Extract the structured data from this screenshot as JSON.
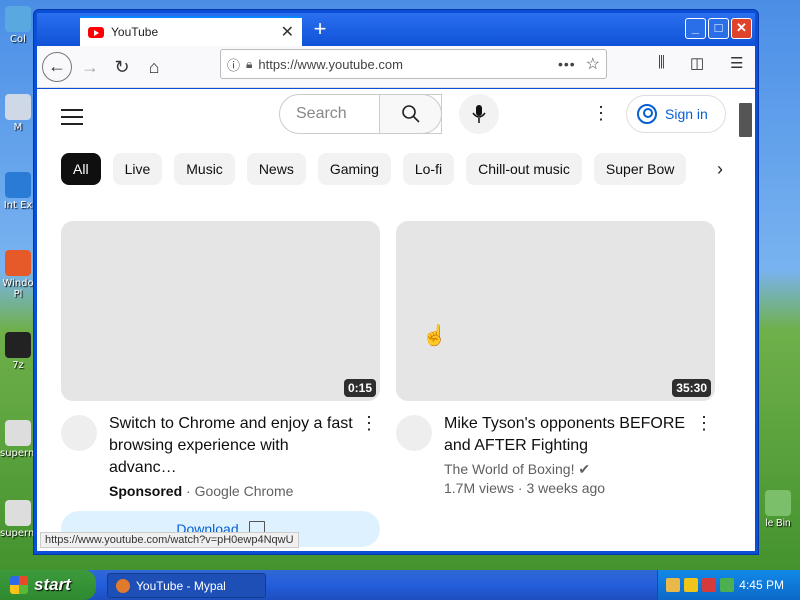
{
  "desktop": {
    "icons_left": [
      "Col",
      "M",
      "Int\nEx",
      "Windo\nPl",
      "7z",
      "superm",
      "superm"
    ],
    "icon_right": "le Bin"
  },
  "browser": {
    "tab_title": "YouTube",
    "new_tab": "+",
    "url": "https://www.youtube.com",
    "status_url": "https://www.youtube.com/watch?v=pH0ewp4NqwU"
  },
  "youtube": {
    "search_placeholder": "Search",
    "signin_label": "Sign in",
    "chips": [
      "All",
      "Live",
      "Music",
      "News",
      "Gaming",
      "Lo-fi",
      "Chill-out music",
      "Super Bow"
    ],
    "videos": [
      {
        "title": "Switch to Chrome and enjoy a fast browsing experience with advanc…",
        "sponsored": "Sponsored",
        "channel": "· Google Chrome",
        "duration": "0:15",
        "action": "Download"
      },
      {
        "title": "Mike Tyson's opponents BEFORE and AFTER Fighting",
        "channel": "The World of Boxing!",
        "stats": "1.7M views · 3 weeks ago",
        "duration": "35:30"
      }
    ]
  },
  "taskbar": {
    "start_label": "start",
    "task_label": "YouTube - Mypal",
    "clock": "4:45 PM"
  }
}
